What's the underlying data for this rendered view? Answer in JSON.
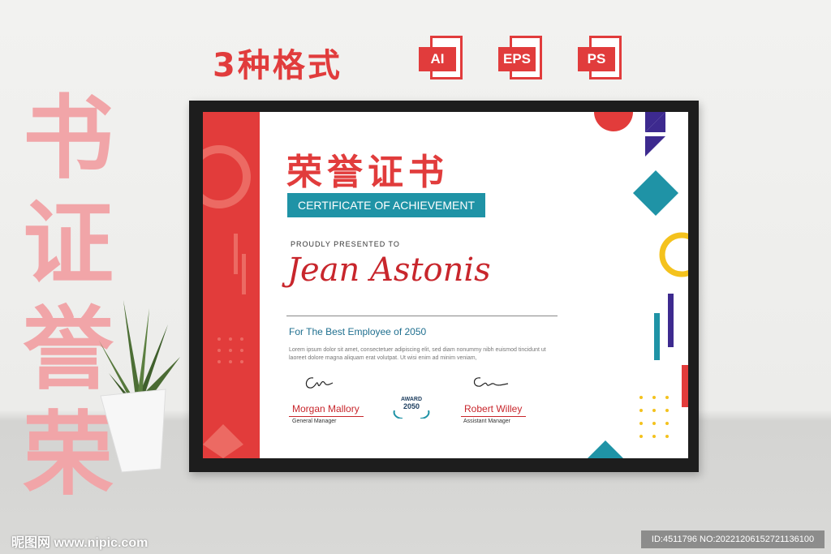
{
  "promo": {
    "headline": "3种格式",
    "formats": [
      {
        "label": "AI",
        "icon": "ai-file-icon"
      },
      {
        "label": "EPS",
        "icon": "eps-file-icon"
      },
      {
        "label": "PS",
        "icon": "ps-file-icon"
      }
    ],
    "side_chars": [
      "书",
      "证",
      "誉",
      "荣"
    ]
  },
  "certificate": {
    "title_cn": "荣誉证书",
    "subtitle": "CERTIFICATE OF ACHIEVEMENT",
    "presented_label": "PROUDLY PRESENTED TO",
    "recipient_name": "Jean Astonis",
    "reason": "For The Best Employee of 2050",
    "body_text": "Lorem ipsum dolor sit amet, consectetuer adipiscing elit, sed diam nonummy nibh euismod tincidunt ut laoreet dolore magna aliquam erat volutpat. Ut wisi enim ad minim veniam,",
    "award_badge": {
      "line1": "AWARD",
      "line2": "2050"
    },
    "signatories": [
      {
        "name": "Morgan Mallory",
        "role": "General Manager"
      },
      {
        "name": "Robert Willey",
        "role": "Assistant Manager"
      }
    ],
    "colors": {
      "red": "#e23c3b",
      "teal": "#1f93a6",
      "purple": "#3d2a8f",
      "yellow": "#f4c21d"
    }
  },
  "watermark": {
    "site": "昵图网 www.nipic.com",
    "id_text": "ID:4511796 NO:20221206152721136100"
  }
}
